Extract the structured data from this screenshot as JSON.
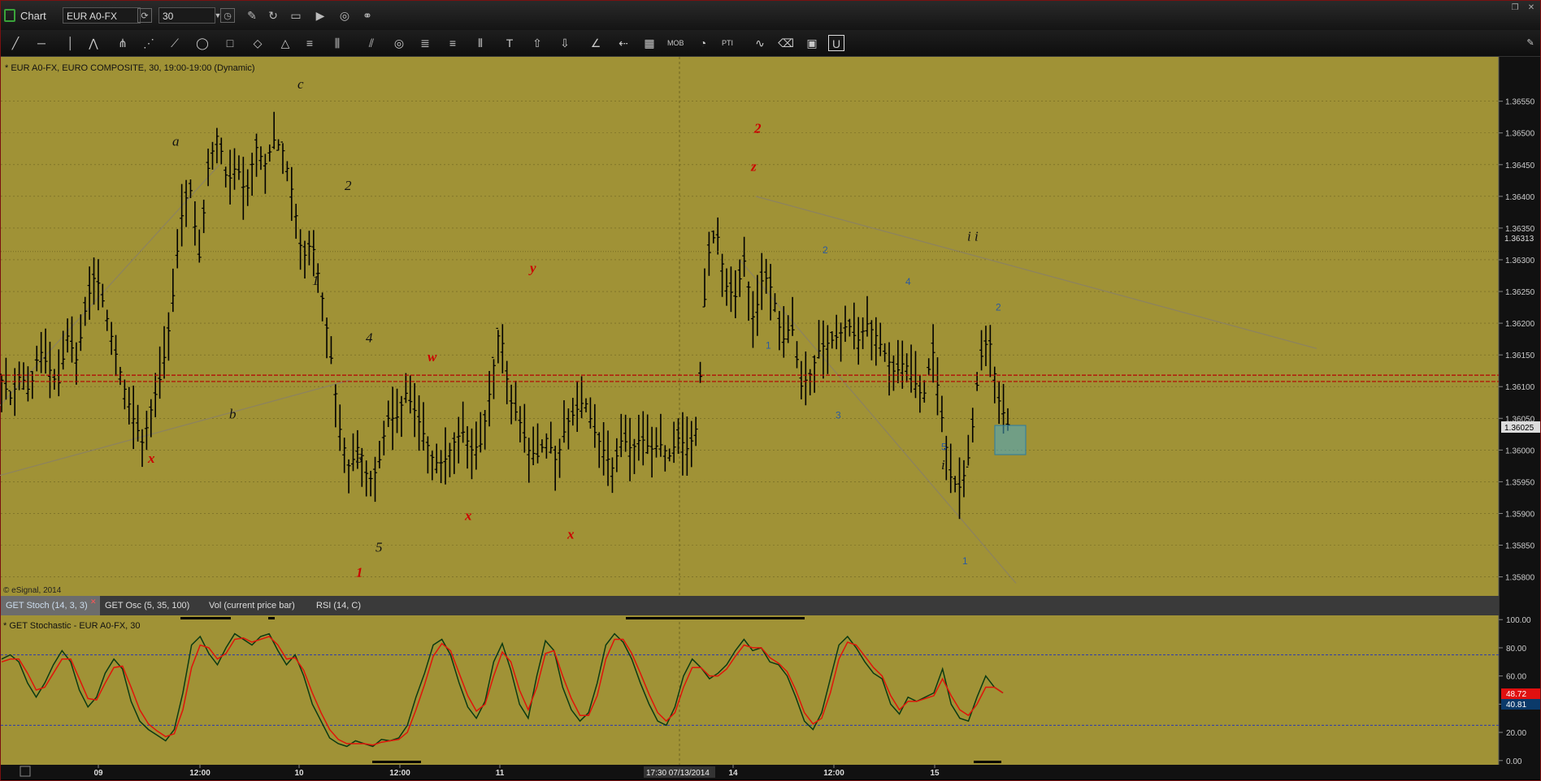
{
  "window": {
    "title": "Chart",
    "symbol": "EUR A0-FX",
    "interval": "30"
  },
  "toolbar_icons": [
    "line-icon",
    "hline-icon",
    "vline-icon",
    "zigzag-icon",
    "pitchfork-icon",
    "fan-icon",
    "gann-icon",
    "ellipse-icon",
    "rectangle-icon",
    "eraser-icon",
    "triangle-icon",
    "channel-icon",
    "regression-icon",
    "parallel-icon",
    "circle-icon",
    "fib-icon",
    "fib-ext-icon",
    "cycle-icon",
    "text-icon",
    "arrow-up-icon",
    "arrow-down-icon",
    "angle-icon",
    "arrow-left-icon",
    "grid-icon",
    "mob-icon",
    "time-icon",
    "pti-icon",
    "wave-icon",
    "eraser2-icon",
    "screenshot-icon",
    "magnet-icon"
  ],
  "colors": {
    "chart_bg": "#A09236",
    "bar": "#000000",
    "wave_red": "#cc0000",
    "wave_black": "#111111",
    "wave_blue": "#2a5aa0",
    "stoch_k": "#0b3a12",
    "stoch_d": "#e0140a",
    "ref_line_red": "#b50000"
  },
  "price_pane": {
    "header": "* EUR A0-FX, EURO COMPOSITE, 30, 19:00-19:00 (Dynamic)",
    "footer": "© eSignal, 2014",
    "current_label": "1.36025",
    "hline_label": "1.36313"
  },
  "stoch_pane": {
    "header": "* GET Stochastic - EUR A0-FX, 30",
    "k_label": "48.72",
    "d_label": "40.81"
  },
  "pane_tabs": [
    {
      "label": "GET Stoch (14, 3, 3)",
      "active": true
    },
    {
      "label": "GET Osc (5, 35, 100)",
      "active": false
    },
    {
      "label": "Vol (current price bar)",
      "active": false
    },
    {
      "label": "RSI (14, C)",
      "active": false
    }
  ],
  "time_axis": {
    "crosshair_label": "17:30 07/13/2014"
  },
  "chart_data": [
    {
      "type": "ohlc",
      "title": "* EUR A0-FX, EURO COMPOSITE, 30, 19:00-19:00 (Dynamic)",
      "y_ticks": [
        "1.35800",
        "1.35850",
        "1.35900",
        "1.35950",
        "1.36000",
        "1.36050",
        "1.36100",
        "1.36150",
        "1.36200",
        "1.36250",
        "1.36300",
        "1.36350",
        "1.36400",
        "1.36450",
        "1.36500",
        "1.36550"
      ],
      "ylim": [
        1.3577,
        1.3662
      ],
      "x_ticks": [
        "09",
        "12:00",
        "10",
        "12:00",
        "11",
        "14",
        "12:00",
        "15"
      ],
      "last_price": 1.36025,
      "reference_lines": [
        1.36108,
        1.36118
      ],
      "crosshair_x_label": "17:30 07/13/2014",
      "close_path": [
        1.3611,
        1.3608,
        1.3612,
        1.3609,
        1.3616,
        1.3613,
        1.361,
        1.3618,
        1.3614,
        1.3623,
        1.3628,
        1.3622,
        1.3616,
        1.361,
        1.3605,
        1.3601,
        1.3607,
        1.3612,
        1.3621,
        1.3636,
        1.3642,
        1.363,
        1.3645,
        1.365,
        1.3642,
        1.3645,
        1.364,
        1.3648,
        1.3645,
        1.3649,
        1.3647,
        1.364,
        1.363,
        1.3633,
        1.3625,
        1.3615,
        1.3603,
        1.3597,
        1.3601,
        1.3595,
        1.3597,
        1.3605,
        1.3605,
        1.3609,
        1.3606,
        1.3602,
        1.3598,
        1.3598,
        1.3601,
        1.3603,
        1.36,
        1.3601,
        1.361,
        1.362,
        1.3608,
        1.3605,
        1.36,
        1.3599,
        1.3602,
        1.3598,
        1.3604,
        1.3606,
        1.3608,
        1.3603,
        1.36,
        1.3597,
        1.3602,
        1.36,
        1.3602,
        1.36,
        1.3601,
        1.3599,
        1.3602,
        1.36,
        1.3604,
        1.363,
        1.3635,
        1.3626,
        1.3624,
        1.363,
        1.362,
        1.3628,
        1.3625,
        1.3617,
        1.362,
        1.361,
        1.3612,
        1.3616,
        1.3617,
        1.3618,
        1.362,
        1.3617,
        1.362,
        1.3618,
        1.3615,
        1.3612,
        1.3614,
        1.3611,
        1.3608,
        1.3616,
        1.3605,
        1.3595,
        1.3594,
        1.36,
        1.3614,
        1.3618,
        1.3608,
        1.3604
      ],
      "wave_labels": [
        {
          "text": "c",
          "color": "black",
          "price": 1.3657
        },
        {
          "text": "a",
          "color": "black",
          "price": 1.3648
        },
        {
          "text": "2",
          "color": "black",
          "price": 1.3641
        },
        {
          "text": "1",
          "color": "black",
          "price": 1.3626
        },
        {
          "text": "4",
          "color": "black",
          "price": 1.3617
        },
        {
          "text": "b",
          "color": "black",
          "price": 1.3605
        },
        {
          "text": "x",
          "color": "red",
          "price": 1.3598
        },
        {
          "text": "3",
          "color": "black",
          "price": 1.3598
        },
        {
          "text": "5",
          "color": "black",
          "price": 1.3584
        },
        {
          "text": "1",
          "color": "red",
          "price": 1.358
        },
        {
          "text": "w",
          "color": "red",
          "price": 1.3614
        },
        {
          "text": "x",
          "color": "red",
          "price": 1.3589
        },
        {
          "text": "y",
          "color": "red",
          "price": 1.3628
        },
        {
          "text": "x",
          "color": "red",
          "price": 1.3586
        },
        {
          "text": "2",
          "color": "red",
          "price": 1.365
        },
        {
          "text": "z",
          "color": "red",
          "price": 1.3644
        },
        {
          "text": "1",
          "color": "blue",
          "price": 1.3616
        },
        {
          "text": "2",
          "color": "blue",
          "price": 1.3631
        },
        {
          "text": "3",
          "color": "blue",
          "price": 1.3605
        },
        {
          "text": "4",
          "color": "blue",
          "price": 1.3626
        },
        {
          "text": "5",
          "color": "blue",
          "price": 1.36
        },
        {
          "text": "i",
          "color": "black",
          "price": 1.3597
        },
        {
          "text": "i i",
          "color": "black",
          "price": 1.3633
        },
        {
          "text": "1",
          "color": "blue",
          "price": 1.3582
        },
        {
          "text": "2",
          "color": "blue",
          "price": 1.3622
        }
      ]
    },
    {
      "type": "line",
      "title": "* GET Stochastic - EUR A0-FX, 30",
      "y_ticks": [
        "0.00",
        "20.00",
        "40.00",
        "60.00",
        "80.00",
        "100.00"
      ],
      "ylim": [
        -3,
        103
      ],
      "reference_levels": [
        75,
        25
      ],
      "series": [
        {
          "values": [
            72,
            75,
            70,
            55,
            45,
            55,
            68,
            78,
            70,
            50,
            38,
            45,
            62,
            72,
            65,
            42,
            28,
            22,
            18,
            14,
            22,
            48,
            82,
            88,
            76,
            68,
            80,
            90,
            86,
            82,
            88,
            90,
            78,
            68,
            75,
            60,
            40,
            28,
            16,
            12,
            10,
            14,
            12,
            10,
            15,
            14,
            16,
            25,
            45,
            62,
            82,
            86,
            75,
            55,
            38,
            30,
            42,
            70,
            83,
            64,
            40,
            30,
            60,
            85,
            78,
            52,
            36,
            28,
            34,
            55,
            82,
            90,
            84,
            72,
            55,
            40,
            28,
            25,
            38,
            60,
            72,
            66,
            58,
            62,
            68,
            78,
            86,
            78,
            80,
            70,
            68,
            60,
            45,
            28,
            22,
            34,
            58,
            82,
            88,
            80,
            70,
            62,
            58,
            40,
            33,
            45,
            42,
            45,
            48,
            65,
            40,
            30,
            28,
            45,
            60,
            52,
            48
          ]
        },
        {
          "values": [
            70,
            72,
            72,
            62,
            50,
            52,
            62,
            72,
            72,
            58,
            44,
            43,
            55,
            66,
            67,
            52,
            36,
            26,
            21,
            17,
            19,
            36,
            66,
            82,
            80,
            72,
            76,
            86,
            87,
            84,
            86,
            88,
            82,
            72,
            73,
            64,
            48,
            34,
            22,
            15,
            12,
            12,
            12,
            11,
            13,
            14,
            15,
            20,
            36,
            54,
            74,
            83,
            78,
            62,
            46,
            35,
            40,
            60,
            77,
            70,
            50,
            36,
            52,
            76,
            78,
            60,
            44,
            32,
            32,
            46,
            72,
            86,
            86,
            76,
            62,
            47,
            34,
            28,
            34,
            52,
            66,
            66,
            60,
            60,
            65,
            74,
            82,
            80,
            80,
            73,
            69,
            63,
            50,
            34,
            26,
            30,
            48,
            72,
            84,
            82,
            74,
            66,
            60,
            46,
            36,
            42,
            42,
            44,
            46,
            58,
            46,
            36,
            32,
            40,
            52,
            52,
            48
          ]
        }
      ]
    }
  ]
}
